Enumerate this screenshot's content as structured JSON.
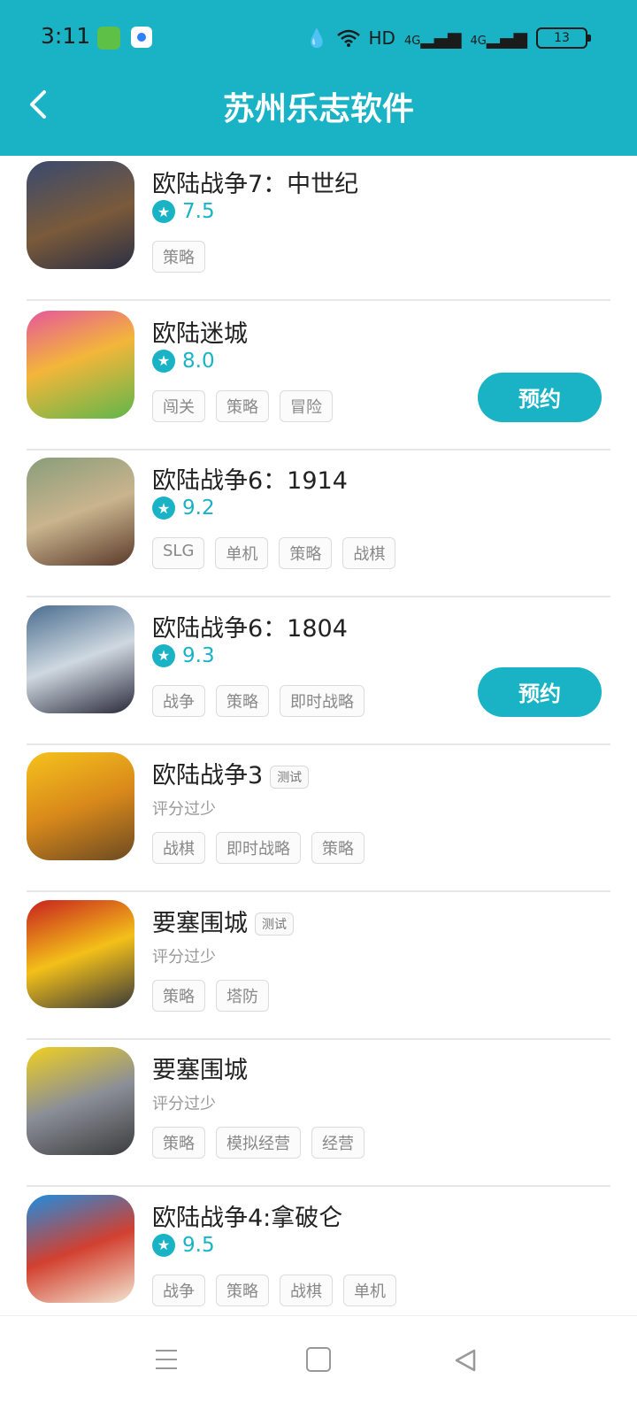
{
  "status_bar": {
    "time": "3:11",
    "right_text": "HD",
    "network_1": "4G",
    "network_2": "4G",
    "battery": "13"
  },
  "header": {
    "title": "苏州乐志软件"
  },
  "colors": {
    "accent": "#1ab3c6"
  },
  "games": [
    {
      "name": "欧陆战争7：中世纪",
      "score": "7.5",
      "rating_text": "",
      "test_badge": "",
      "tags": [
        "策略"
      ],
      "reserve": ""
    },
    {
      "name": "欧陆迷城",
      "score": "8.0",
      "rating_text": "",
      "test_badge": "",
      "tags": [
        "闯关",
        "策略",
        "冒险"
      ],
      "reserve": "预约"
    },
    {
      "name": "欧陆战争6：1914",
      "score": "9.2",
      "rating_text": "",
      "test_badge": "",
      "tags": [
        "SLG",
        "单机",
        "策略",
        "战棋"
      ],
      "reserve": ""
    },
    {
      "name": "欧陆战争6：1804",
      "score": "9.3",
      "rating_text": "",
      "test_badge": "",
      "tags": [
        "战争",
        "策略",
        "即时战略"
      ],
      "reserve": "预约"
    },
    {
      "name": "欧陆战争3",
      "score": "",
      "rating_text": "评分过少",
      "test_badge": "测试",
      "tags": [
        "战棋",
        "即时战略",
        "策略"
      ],
      "reserve": ""
    },
    {
      "name": "要塞围城",
      "score": "",
      "rating_text": "评分过少",
      "test_badge": "测试",
      "tags": [
        "策略",
        "塔防"
      ],
      "reserve": ""
    },
    {
      "name": "要塞围城",
      "score": "",
      "rating_text": "评分过少",
      "test_badge": "",
      "tags": [
        "策略",
        "模拟经营",
        "经营"
      ],
      "reserve": ""
    },
    {
      "name": "欧陆战争4:拿破仑",
      "score": "9.5",
      "rating_text": "",
      "test_badge": "",
      "tags": [
        "战争",
        "策略",
        "战棋",
        "单机"
      ],
      "reserve": ""
    }
  ]
}
